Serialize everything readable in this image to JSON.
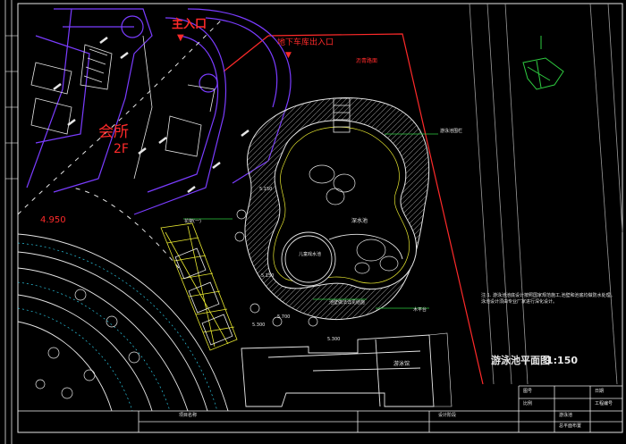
{
  "labels": {
    "main_entrance": "主入口",
    "garage_entrance": "地下车库出入口",
    "clubhouse": "会所",
    "clubhouse_floor": "2F",
    "elevation_4950": "4.950",
    "pool_plan_title": "游泳池平面图",
    "pool_plan_scale": "1:150",
    "fence_note": "游泳池围栏",
    "deep_pool": "深水池",
    "kids_pool": "儿童戏水池",
    "main_pool_note": "游泳池",
    "elev_a": "5.150",
    "elev_b": "5.150",
    "elev_c": "5.300",
    "elev_d": "5.300",
    "elev_e": "5.700",
    "building_label": "游泳馆",
    "pool_edge_note": "池壁做法详见结施",
    "pergola_note": "花架(一)",
    "deck_note": "木平台",
    "road_note": "沥青路面",
    "general_note": "注:1. 游泳池池底设计按照国家规范施工,池壁和池底均做防水处理。泳池设计须由专业厂家进行深化设计。"
  },
  "title_block": {
    "cell_1": "项目名称",
    "cell_2": "设计阶段",
    "cell_3": "游泳池",
    "cell_4": "总平面布置",
    "cell_5": "图号",
    "cell_6": "比例",
    "cell_7": "日期",
    "cell_8": "工程编号"
  },
  "colors": {
    "background": "#000000",
    "purple_lines": "#7a3cff",
    "red_lines": "#ff2a2a",
    "white_lines": "#e6e6e6",
    "yellow_lines": "#e8e830",
    "green_lines": "#2ecc40",
    "cyan_lines": "#30e0ff",
    "grey_hatch": "#8a8a8a"
  }
}
